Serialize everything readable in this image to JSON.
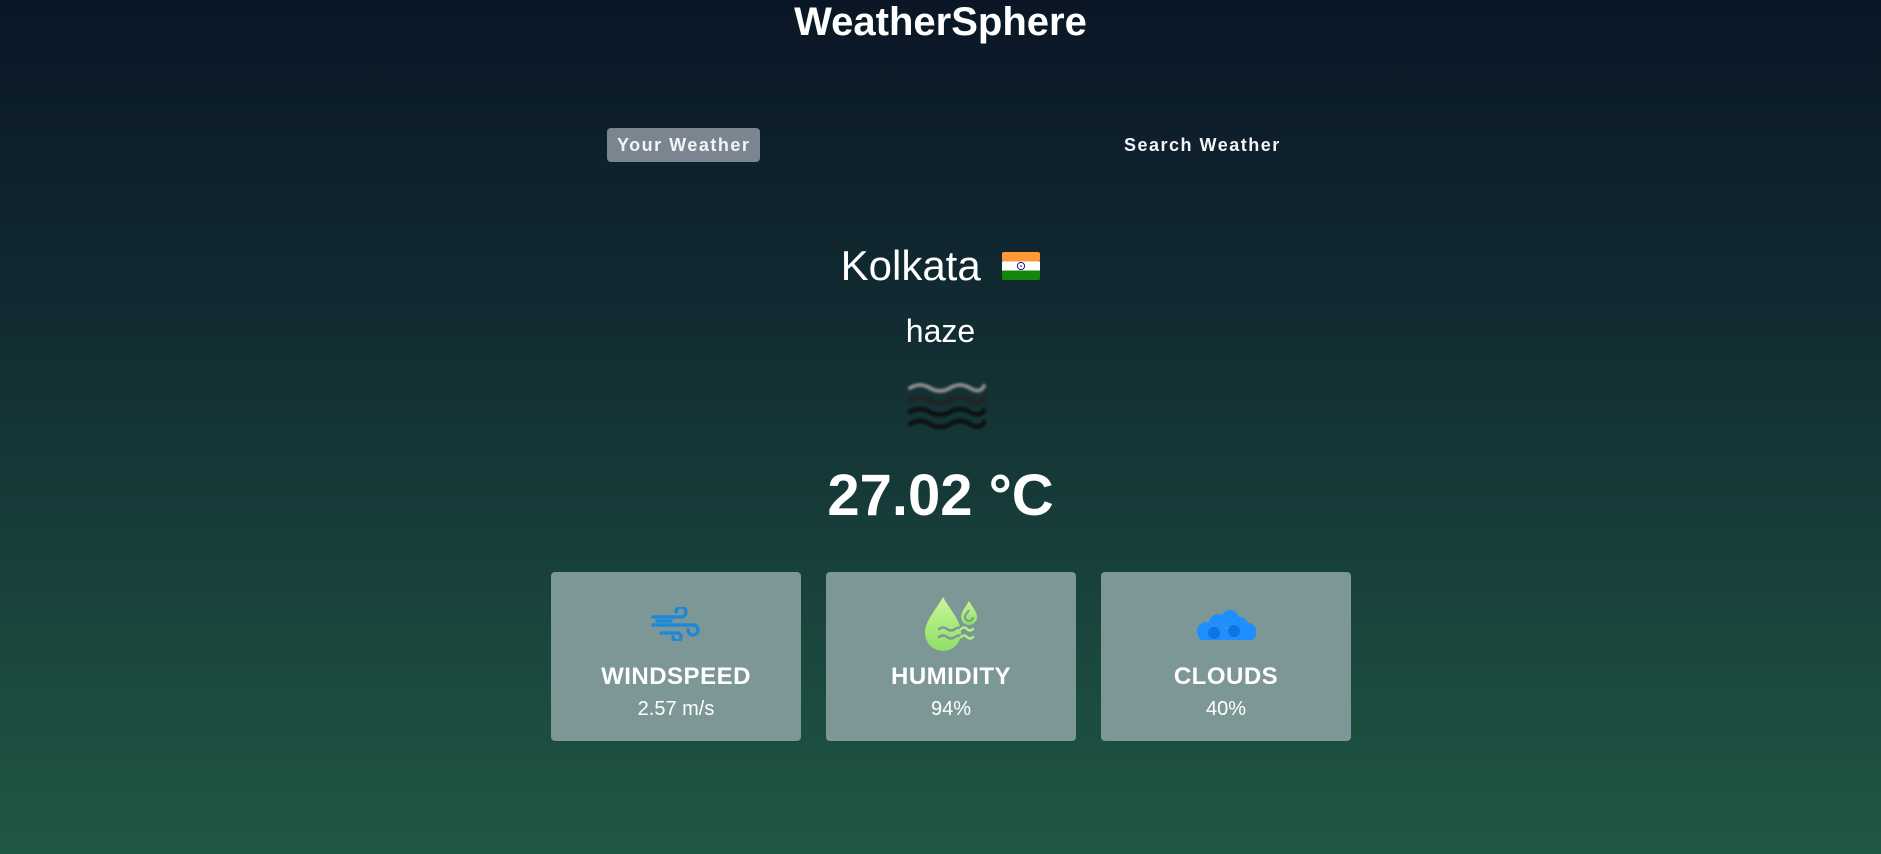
{
  "app": {
    "title": "WeatherSphere"
  },
  "tabs": [
    {
      "label": "Your Weather",
      "active": true
    },
    {
      "label": "Search Weather",
      "active": false
    }
  ],
  "location": {
    "city": "Kolkata",
    "flag_icon": "india-flag-icon"
  },
  "weather": {
    "condition": "haze",
    "icon": "haze-icon",
    "temperature": "27.02 °C"
  },
  "stats": [
    {
      "label": "WINDSPEED",
      "value": "2.57 m/s",
      "icon": "wind-icon",
      "icon_color": "#1e88d8"
    },
    {
      "label": "HUMIDITY",
      "value": "94%",
      "icon": "humidity-drops-icon",
      "icon_color": "#b3f07f"
    },
    {
      "label": "CLOUDS",
      "value": "40%",
      "icon": "clouds-icon",
      "icon_color": "#1f8fff"
    }
  ],
  "colors": {
    "active_tab_bg": "#7b8590",
    "card_bg": "#7c9795",
    "bg_top": "#0a1626",
    "bg_bottom": "#1f5844"
  }
}
